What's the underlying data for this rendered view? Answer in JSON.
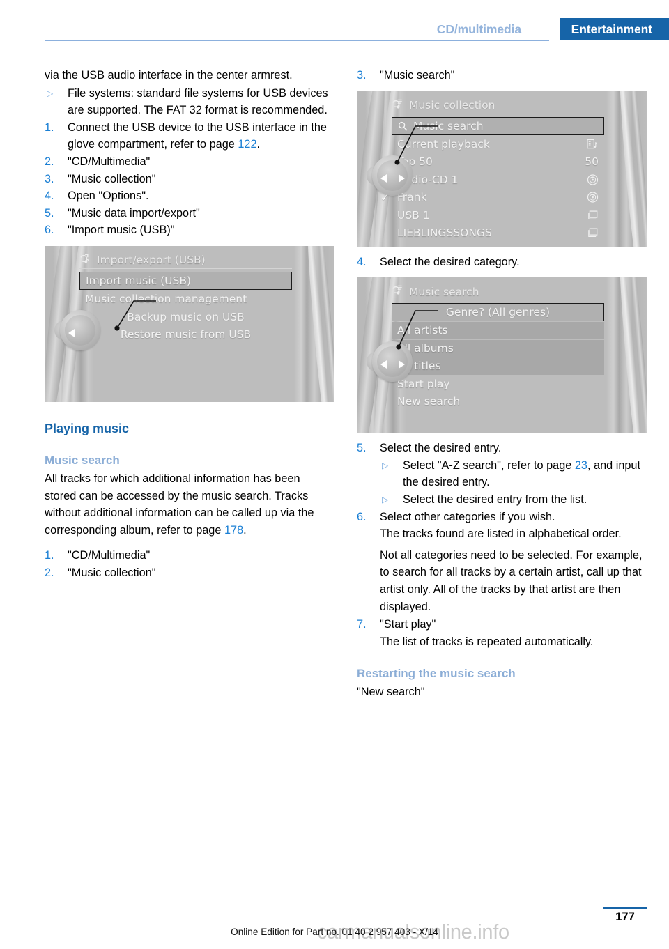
{
  "header": {
    "secondary_tab": "CD/multimedia",
    "primary_tab": "Entertainment",
    "accent_color": "#1664a8",
    "secondary_color": "#94b4dc"
  },
  "left_column": {
    "intro_paragraph": "via the USB audio interface in the center armrest.",
    "bullet_filesystems": "File systems: standard file systems for USB devices are supported. The FAT 32 format is recommended.",
    "steps": [
      {
        "num": "1.",
        "text_before": "Connect the USB device to the USB interface in the glove compartment, refer to page ",
        "pageref": "122",
        "text_after": "."
      },
      {
        "num": "2.",
        "text_before": "\"CD/Multimedia\"",
        "pageref": "",
        "text_after": ""
      },
      {
        "num": "3.",
        "text_before": "\"Music collection\"",
        "pageref": "",
        "text_after": ""
      },
      {
        "num": "4.",
        "text_before": "Open \"Options\".",
        "pageref": "",
        "text_after": ""
      },
      {
        "num": "5.",
        "text_before": "\"Music data import/export\"",
        "pageref": "",
        "text_after": ""
      },
      {
        "num": "6.",
        "text_before": "\"Import music (USB)\"",
        "pageref": "",
        "text_after": ""
      }
    ],
    "figure_import_export": {
      "title": "Import/export (USB)",
      "title_icon": "music-note-export-icon",
      "rows": [
        {
          "label": "Import music (USB)",
          "selected": true,
          "align": "left"
        },
        {
          "label": "Music collection management",
          "selected": false,
          "align": "left"
        },
        {
          "label": "Backup music on USB",
          "selected": false,
          "align": "center"
        },
        {
          "label": "Restore music from USB",
          "selected": false,
          "align": "center"
        }
      ],
      "knob": {
        "left_arrow": true,
        "right_arrow": false
      }
    },
    "heading_playing_music": "Playing music",
    "heading_music_search": "Music search",
    "music_search_paragraph_before": "All tracks for which additional information has been stored can be accessed by the music search. Tracks without additional information can be called up via the corresponding album, refer to page ",
    "music_search_pageref": "178",
    "music_search_paragraph_after": ".",
    "steps2": [
      {
        "num": "1.",
        "text": "\"CD/Multimedia\""
      },
      {
        "num": "2.",
        "text": "\"Music collection\""
      }
    ]
  },
  "right_column": {
    "step3": {
      "num": "3.",
      "text": "\"Music search\""
    },
    "figure_music_collection": {
      "title": "Music collection",
      "title_icon": "music-note-list-icon",
      "rows": [
        {
          "label": "Music search",
          "selected": true,
          "left_icon": "magnifier-icon",
          "right_icon": "",
          "checked": false
        },
        {
          "label": "Current playback",
          "selected": false,
          "left_icon": "",
          "right_icon": "playlist-info-icon",
          "checked": false
        },
        {
          "label": "Top 50",
          "selected": false,
          "left_icon": "",
          "right_icon": "50",
          "checked": false
        },
        {
          "label": "Audio-CD 1",
          "selected": false,
          "left_icon": "",
          "right_icon": "cd-disc-icon",
          "checked": false
        },
        {
          "label": "Frank",
          "selected": false,
          "left_icon": "",
          "right_icon": "cd-disc-icon",
          "checked": true
        },
        {
          "label": "USB 1",
          "selected": false,
          "left_icon": "",
          "right_icon": "folder-icon",
          "checked": false
        },
        {
          "label": "LIEBLINGSSONGS",
          "selected": false,
          "left_icon": "",
          "right_icon": "folder-icon",
          "checked": false
        }
      ],
      "knob": {
        "left_arrow": true,
        "right_arrow": true
      }
    },
    "step4": {
      "num": "4.",
      "text": "Select the desired category."
    },
    "figure_music_search": {
      "title": "Music search",
      "title_icon": "music-note-list-icon",
      "rows": [
        {
          "label": "Genre? (All genres)",
          "selected": true,
          "shaded": true
        },
        {
          "label": "All artists",
          "selected": false,
          "shaded": true
        },
        {
          "label": "All albums",
          "selected": false,
          "shaded": true
        },
        {
          "label": "All titles",
          "selected": false,
          "shaded": true
        },
        {
          "label": "Start play",
          "selected": false,
          "shaded": false
        },
        {
          "label": "New search",
          "selected": false,
          "shaded": false
        }
      ],
      "knob": {
        "left_arrow": true,
        "right_arrow": true
      }
    },
    "step5": {
      "num": "5.",
      "text": "Select the desired entry."
    },
    "step5_sub": [
      {
        "text_before": "Select \"A-Z search\", refer to page ",
        "pageref": "23",
        "text_after": ", and input the desired entry."
      },
      {
        "text_before": "Select the desired entry from the list.",
        "pageref": "",
        "text_after": ""
      }
    ],
    "step6": {
      "num": "6.",
      "text": "Select other categories if you wish."
    },
    "step6_note1": "The tracks found are listed in alphabetical order.",
    "step6_note2": "Not all categories need to be selected. For example, to search for all tracks by a certain artist, call up that artist only. All of the tracks by that artist are then displayed.",
    "step7": {
      "num": "7.",
      "text": "\"Start play\""
    },
    "step7_note": "The list of tracks is repeated automatically.",
    "heading_restarting": "Restarting the music search",
    "restarting_text": "\"New search\""
  },
  "footer": {
    "page_number": "177",
    "edition_line": "Online Edition for Part no. 01 40 2 957 403 - X/14",
    "watermark": "carmanualsonline.info"
  }
}
